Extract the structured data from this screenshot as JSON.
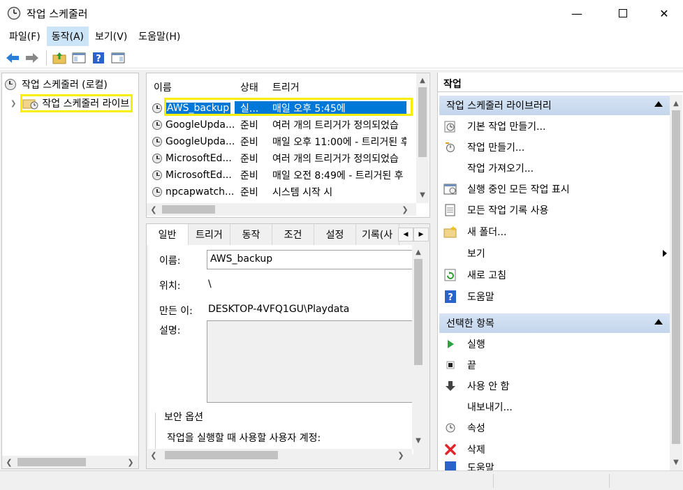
{
  "window": {
    "title": "작업 스케줄러"
  },
  "menu": [
    "파일(F)",
    "동작(A)",
    "보기(V)",
    "도움말(H)"
  ],
  "toolbar_icons": [
    "back-arrow-icon",
    "forward-arrow-icon",
    "folder-up-icon",
    "show-hide-console-tree-icon",
    "help-icon",
    "show-hide-action-pane-icon"
  ],
  "tree": {
    "root": "작업 스케줄러 (로컬)",
    "child": "작업 스케줄러 라이브"
  },
  "tasklist": {
    "columns": [
      "이름",
      "상태",
      "트리거"
    ],
    "rows": [
      {
        "name": "AWS_backup",
        "status": "실...",
        "trigger": "매일 오후 5:45에"
      },
      {
        "name": "GoogleUpda...",
        "status": "준비",
        "trigger": "여러 개의 트리거가 정의되었습"
      },
      {
        "name": "GoogleUpda...",
        "status": "준비",
        "trigger": "매일 오후 11:00에 - 트리거된 후"
      },
      {
        "name": "MicrosoftEd...",
        "status": "준비",
        "trigger": "여러 개의 트리거가 정의되었습"
      },
      {
        "name": "MicrosoftEd...",
        "status": "준비",
        "trigger": "매일 오전 8:49에 - 트리거된 후"
      },
      {
        "name": "npcapwatch...",
        "status": "준비",
        "trigger": "시스템 시작 시"
      }
    ]
  },
  "detail": {
    "tabs": [
      "일반",
      "트리거",
      "동작",
      "조건",
      "설정",
      "기록(사"
    ],
    "name_label": "이름:",
    "name_value": "AWS_backup",
    "location_label": "위치:",
    "location_value": "\\",
    "author_label": "만든 이:",
    "author_value": "DESKTOP-4VFQ1GU\\Playdata",
    "description_label": "설명:",
    "security_group": "보안 옵션",
    "security_text": "작업을 실행할 때 사용할 사용자 계정:"
  },
  "actions": {
    "header": "작업",
    "section1": "작업 스케줄러 라이브러리",
    "items1": [
      {
        "label": "기본 작업 만들기...",
        "icon": "basic-task-icon"
      },
      {
        "label": "작업 만들기...",
        "icon": "create-task-icon"
      },
      {
        "label": "작업 가져오기...",
        "icon": ""
      },
      {
        "label": "실행 중인 모든 작업 표시",
        "icon": "running-tasks-icon"
      },
      {
        "label": "모든 작업 기록 사용",
        "icon": "task-history-icon"
      },
      {
        "label": "새 폴더...",
        "icon": "new-folder-icon"
      },
      {
        "label": "보기",
        "icon": ""
      },
      {
        "label": "새로 고침",
        "icon": "refresh-icon"
      },
      {
        "label": "도움말",
        "icon": "help-icon"
      }
    ],
    "section2": "선택한 항목",
    "items2": [
      {
        "label": "실행",
        "icon": "run-icon"
      },
      {
        "label": "끝",
        "icon": "stop-icon"
      },
      {
        "label": "사용 안 함",
        "icon": "disable-icon"
      },
      {
        "label": "내보내기...",
        "icon": ""
      },
      {
        "label": "속성",
        "icon": "properties-icon"
      },
      {
        "label": "삭제",
        "icon": "delete-icon"
      },
      {
        "label": "도움말",
        "icon": "help-icon"
      }
    ]
  },
  "colors": {
    "selection": "#0078d7",
    "highlight_box": "#f7ee00",
    "section_header": "#c4d6ec"
  }
}
